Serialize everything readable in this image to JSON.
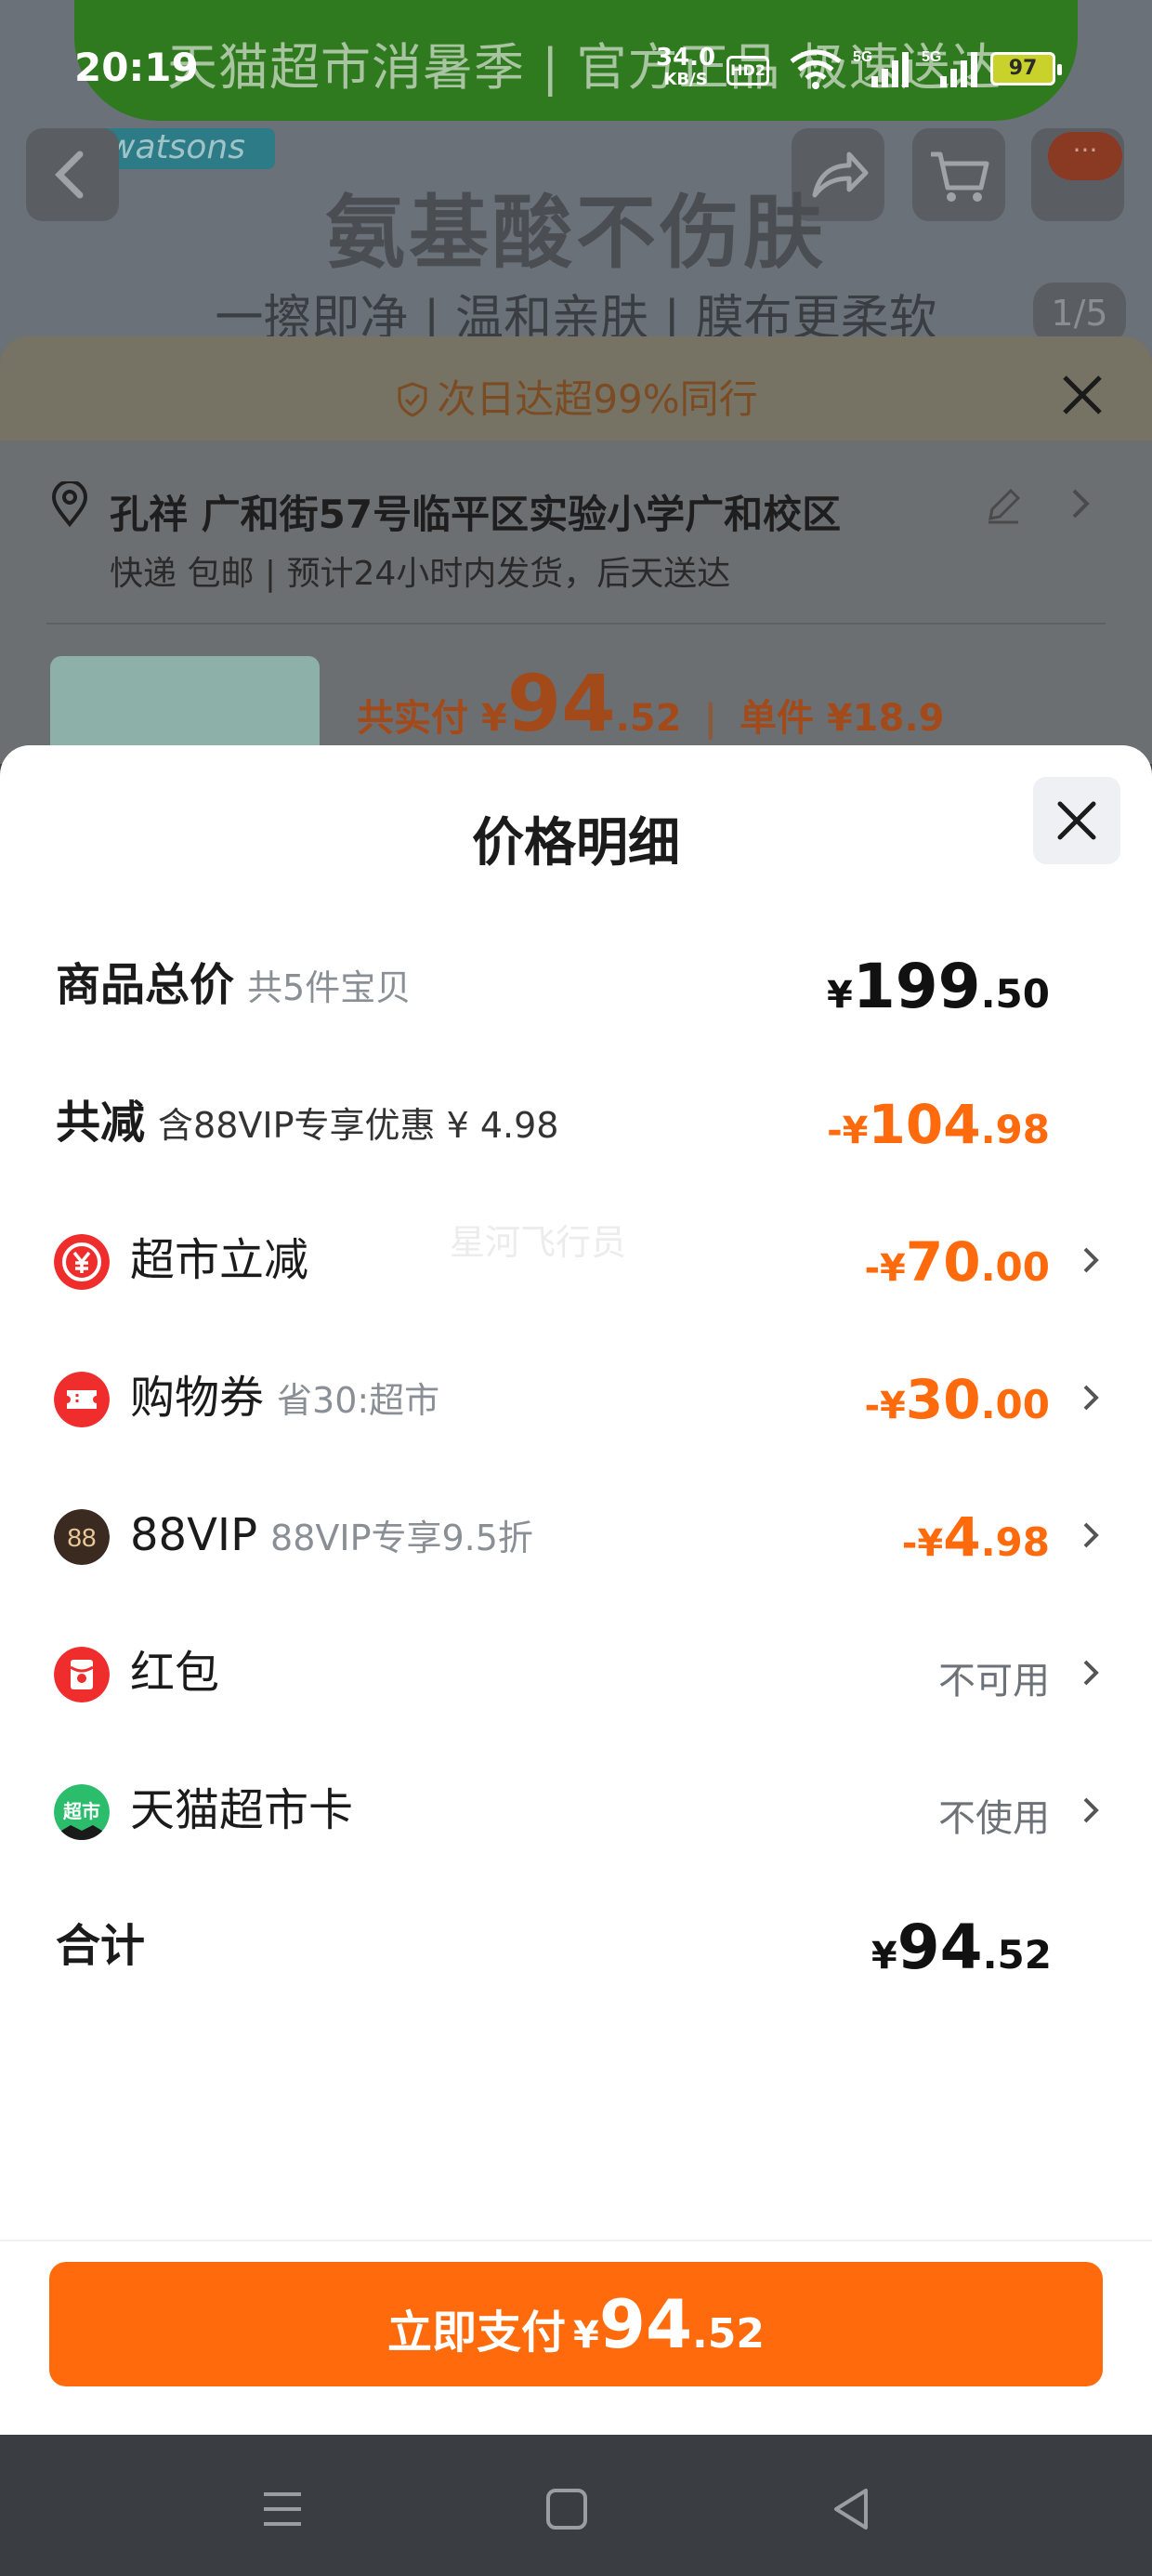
{
  "status_bar": {
    "time": "20:19",
    "net_speed_value": "34.0",
    "net_speed_unit": "KB/S",
    "hd_label": "HD2",
    "sig1_label": "5G",
    "sig2_label": "5G",
    "battery": "97"
  },
  "product_page": {
    "banner_text": "天猫超市消暑季 | 官方正品 极速送达",
    "brand": "watsons",
    "headline": "氨基酸不伤肤",
    "subline": "一擦即净 | 温和亲肤 | 膜布更柔软",
    "image_index": "1/5",
    "message_badge": "···"
  },
  "order_sheet": {
    "delivery_banner": "次日达超99%同行",
    "address": "孔祥 广和街57号临平区实验小学广和校区",
    "shipping": "快递 包邮 | 预计24小时内发货，后天送达",
    "total_label": "共实付",
    "total_yen": "¥",
    "total_int": "94",
    "total_dec": ".52",
    "unit_price": "单件 ¥18.9"
  },
  "price_detail": {
    "title": "价格明细",
    "watermark": "星河飞行员",
    "rows": [
      {
        "label": "商品总价",
        "sub": "共5件宝贝",
        "yen": "¥",
        "int": "199",
        "dec": ".50"
      },
      {
        "label": "共减",
        "sub": "含88VIP专享优惠 ¥ 4.98",
        "yen": "-¥",
        "int": "104",
        "dec": ".98"
      },
      {
        "label": "超市立减",
        "sub": "",
        "yen": "-¥",
        "int": "70",
        "dec": ".00",
        "icon": "yen-circle-icon"
      },
      {
        "label": "购物券",
        "sub": "省30:超市",
        "yen": "-¥",
        "int": "30",
        "dec": ".00",
        "icon": "coupon-icon"
      },
      {
        "label": "88VIP",
        "sub": "88VIP专享9.5折",
        "yen": "-¥",
        "int": "4",
        "dec": ".98",
        "icon": "vip88-icon"
      },
      {
        "label": "红包",
        "status": "不可用",
        "icon": "red-packet-icon"
      },
      {
        "label": "天猫超市卡",
        "status": "不使用",
        "icon": "tmall-card-icon"
      },
      {
        "label": "合计",
        "yen": "¥",
        "int": "94",
        "dec": ".52"
      }
    ],
    "vip_icon_text": "88",
    "card_icon_text": "超市",
    "pay_button": {
      "label": "立即支付",
      "yen": "¥",
      "int": "94",
      "dec": ".52"
    }
  },
  "colors": {
    "accent": "#ff6a0d",
    "coupon_red": "#ef2d2d",
    "vip_dark": "#3b2a20",
    "card_green": "#2bbd6c"
  }
}
